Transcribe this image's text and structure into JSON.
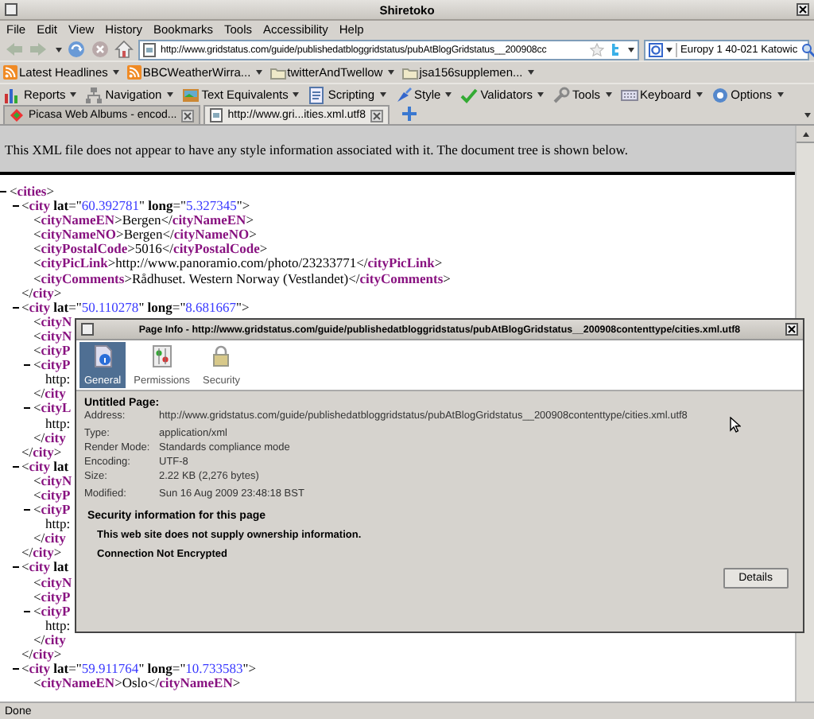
{
  "window": {
    "title": "Shiretoko"
  },
  "menu": [
    "File",
    "Edit",
    "View",
    "History",
    "Bookmarks",
    "Tools",
    "Accessibility",
    "Help"
  ],
  "navigation": {
    "url": "http://www.gridstatus.com/guide/publishedatbloggridstatus/pubAtBlogGridstatus__200908cc",
    "search": "Europy 1 40-021 Katowic"
  },
  "bookmarks": [
    {
      "label": "Latest Headlines",
      "kind": "feed"
    },
    {
      "label": "BBCWeatherWirra...",
      "kind": "feed"
    },
    {
      "label": "twitterAndTwellow",
      "kind": "folder"
    },
    {
      "label": "jsa156supplemen...",
      "kind": "folder"
    }
  ],
  "developer_toolbar": [
    "Reports",
    "Navigation",
    "Text Equivalents",
    "Scripting",
    "Style",
    "Validators",
    "Tools",
    "Keyboard",
    "Options"
  ],
  "tabs": [
    {
      "label": "Picasa Web Albums - encod...",
      "selected": false
    },
    {
      "label": "http://www.gri...ities.xml.utf8",
      "selected": true
    }
  ],
  "page": {
    "notice": "This XML file does not appear to have any style information associated with it. The document tree is shown below.",
    "tree": {
      "expanded": true,
      "open": "<cities>",
      "children": [
        {
          "expanded": true,
          "open": "<city lat=\"60.392781\" long=\"5.327345\">",
          "children": [
            {
              "text": "<cityNameEN>Bergen</cityNameEN>"
            },
            {
              "text": "<cityNameNO>Bergen</cityNameNO>"
            },
            {
              "text": "<cityPostalCode>5016</cityPostalCode>"
            },
            {
              "text": "<cityPicLink>http://www.panoramio.com/photo/23233771</cityPicLink>"
            },
            {
              "text": "<cityComments>Rådhuset. Western Norway (Vestlandet)</cityComments>"
            }
          ],
          "close": "</city>"
        },
        {
          "expanded": true,
          "open": "<city lat=\"50.110278\" long=\"8.681667\">",
          "children": [
            {
              "text": "<cityN"
            },
            {
              "text": "<cityN"
            },
            {
              "text": "<cityP"
            },
            {
              "expanded": true,
              "open": "<cityP",
              "children": [
                {
                  "text": "http:"
                }
              ],
              "close": "</city"
            },
            {
              "expanded": true,
              "open": "<cityL",
              "children": [
                {
                  "text": "http:"
                }
              ],
              "close": "</city"
            }
          ],
          "close": "</city>"
        },
        {
          "expanded": true,
          "open": "<city lat",
          "children": [
            {
              "text": "<cityN"
            },
            {
              "text": "<cityP"
            },
            {
              "expanded": true,
              "open": "<cityP",
              "children": [
                {
                  "text": "http:"
                }
              ],
              "close": "</city"
            }
          ],
          "close": "</city>"
        },
        {
          "expanded": true,
          "open": "<city lat",
          "children": [
            {
              "text": "<cityN"
            },
            {
              "text": "<cityP"
            },
            {
              "expanded": true,
              "open": "<cityP",
              "children": [
                {
                  "text": "http:"
                }
              ],
              "close": "</city"
            }
          ],
          "close": "</city>"
        },
        {
          "expanded": true,
          "open": "<city lat=\"59.911764\" long=\"10.733583\">",
          "children": [
            {
              "text": "<cityNameEN>Oslo</cityNameEN>"
            }
          ]
        }
      ]
    }
  },
  "dialog": {
    "title": "Page Info - http://www.gridstatus.com/guide/publishedatbloggridstatus/pubAtBlogGridstatus__200908contenttype/cities.xml.utf8",
    "tabs": [
      {
        "label": "General",
        "selected": true
      },
      {
        "label": "Permissions",
        "selected": false
      },
      {
        "label": "Security",
        "selected": false
      }
    ],
    "heading": "Untitled Page:",
    "info_groups": [
      [
        {
          "label": "Address:",
          "value": "http://www.gridstatus.com/guide/publishedatbloggridstatus/pubAtBlogGridstatus__200908contenttype/cities.xml.utf8"
        }
      ],
      [
        {
          "label": "Type:",
          "value": "application/xml"
        },
        {
          "label": "Render Mode:",
          "value": "Standards compliance mode"
        },
        {
          "label": "Encoding:",
          "value": "UTF-8"
        },
        {
          "label": "Size:",
          "value": "2.22 KB (2,276 bytes)"
        }
      ],
      [
        {
          "label": "Modified:",
          "value": "Sun 16 Aug 2009 23:48:18 BST"
        }
      ]
    ],
    "security_heading": "Security information for this page",
    "security_lines": [
      "This web site does not supply ownership information.",
      "Connection Not Encrypted"
    ],
    "button": "Details"
  },
  "status_bar": "Done"
}
